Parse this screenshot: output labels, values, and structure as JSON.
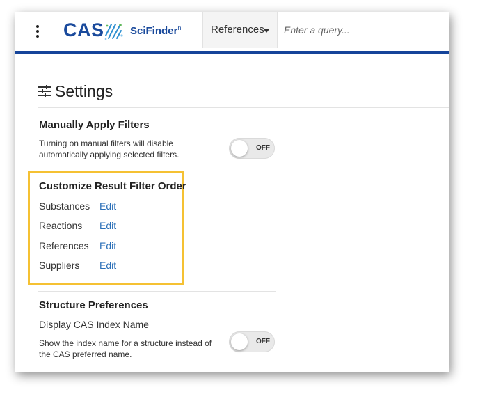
{
  "header": {
    "menu_icon": "kebab-vertical-icon",
    "logo_cas": "CAS",
    "logo_product": "SciFinder",
    "logo_product_sup": "n",
    "search_type": "References",
    "query_placeholder": "Enter a query..."
  },
  "settings": {
    "title": "Settings",
    "icon": "sliders-icon",
    "manual_filters": {
      "heading": "Manually Apply Filters",
      "description_line1": "Turning on manual filters will disable",
      "description_line2": "automatically applying selected filters.",
      "toggle_state": "OFF"
    },
    "filter_order": {
      "heading": "Customize Result Filter Order",
      "items": [
        {
          "label": "Substances",
          "action": "Edit"
        },
        {
          "label": "Reactions",
          "action": "Edit"
        },
        {
          "label": "References",
          "action": "Edit"
        },
        {
          "label": "Suppliers",
          "action": "Edit"
        }
      ]
    },
    "structure_prefs": {
      "heading": "Structure Preferences",
      "subheading": "Display CAS Index Name",
      "description_line1": "Show the index name for a structure instead of",
      "description_line2": "the CAS preferred name.",
      "toggle_state": "OFF"
    }
  },
  "colors": {
    "brand_blue": "#1a4a9c",
    "header_rule": "#15449a",
    "link": "#2a6fb8",
    "highlight": "#f5c133"
  }
}
